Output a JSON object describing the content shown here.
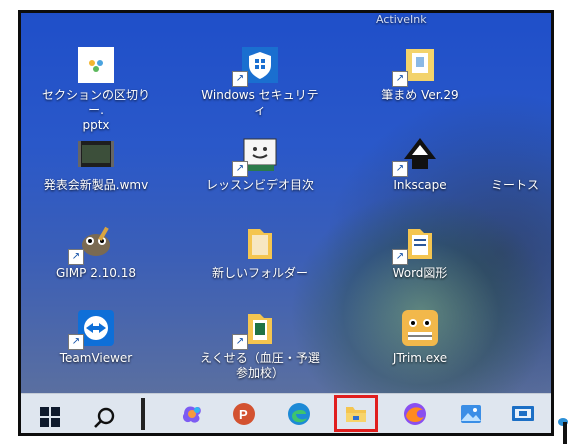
{
  "desktop": {
    "cut_top_label": "ActiveInk",
    "icons": [
      {
        "label": "セクションの区切りー.\npptx",
        "icon": "pptx-file-icon"
      },
      {
        "label": "Windows セキュリテ\nィ",
        "icon": "windows-security-icon"
      },
      {
        "label": "筆まめ Ver.29",
        "icon": "fudemame-icon"
      },
      {
        "label": "発表会新製品.wmv",
        "icon": "video-file-icon"
      },
      {
        "label": "レッスンビデオ目次",
        "icon": "lesson-video-icon"
      },
      {
        "label": "Inkscape",
        "icon": "inkscape-icon"
      },
      {
        "label": "ミートス",
        "icon": "partial-icon"
      },
      {
        "label": "GIMP 2.10.18",
        "icon": "gimp-icon"
      },
      {
        "label": "新しいフォルダー",
        "icon": "folder-icon"
      },
      {
        "label": "Word図形",
        "icon": "folder-icon"
      },
      {
        "label": "TeamViewer",
        "icon": "teamviewer-icon"
      },
      {
        "label": "えくせる（血圧・予選\n参加校）",
        "icon": "folder-icon"
      },
      {
        "label": "JTrim.exe",
        "icon": "jtrim-icon"
      }
    ]
  },
  "taskbar": {
    "items": [
      {
        "name": "start-icon"
      },
      {
        "name": "search-icon"
      },
      {
        "name": "copilot-icon"
      },
      {
        "name": "powerpoint-icon"
      },
      {
        "name": "edge-icon"
      },
      {
        "name": "file-explorer-icon",
        "highlighted": true
      },
      {
        "name": "firefox-icon"
      },
      {
        "name": "photos-icon"
      },
      {
        "name": "remote-desktop-icon"
      }
    ]
  },
  "colors": {
    "highlight": "#e01e1e",
    "taskbar_bg": "#dfe6ef"
  }
}
